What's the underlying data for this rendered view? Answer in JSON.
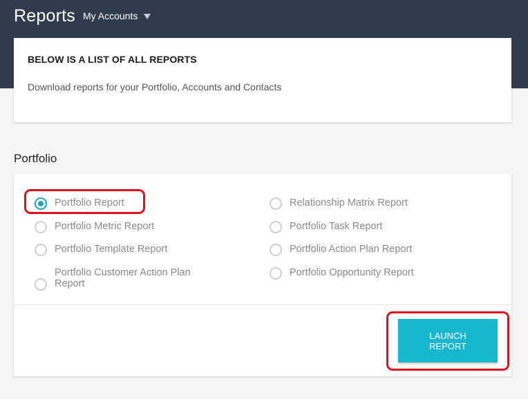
{
  "header": {
    "title": "Reports",
    "account_selector": "My Accounts"
  },
  "info": {
    "heading": "BELOW IS A LIST OF ALL REPORTS",
    "subtext": "Download reports for your Portfolio, Accounts and Contacts"
  },
  "portfolio": {
    "section_title": "Portfolio",
    "selected": "Portfolio Report",
    "reports_left": [
      "Portfolio Report",
      "Portfolio Metric Report",
      "Portfolio Template Report",
      "Portfolio Customer Action Plan Report"
    ],
    "reports_right": [
      "Relationship Matrix Report",
      "Portfolio Task Report",
      "Portfolio Action Plan Report",
      "Portfolio Opportunity Report"
    ],
    "launch_label": "LAUNCH REPORT"
  },
  "colors": {
    "header_bg": "#303c4c",
    "accent": "#17b7d0",
    "highlight": "#e0111a"
  }
}
